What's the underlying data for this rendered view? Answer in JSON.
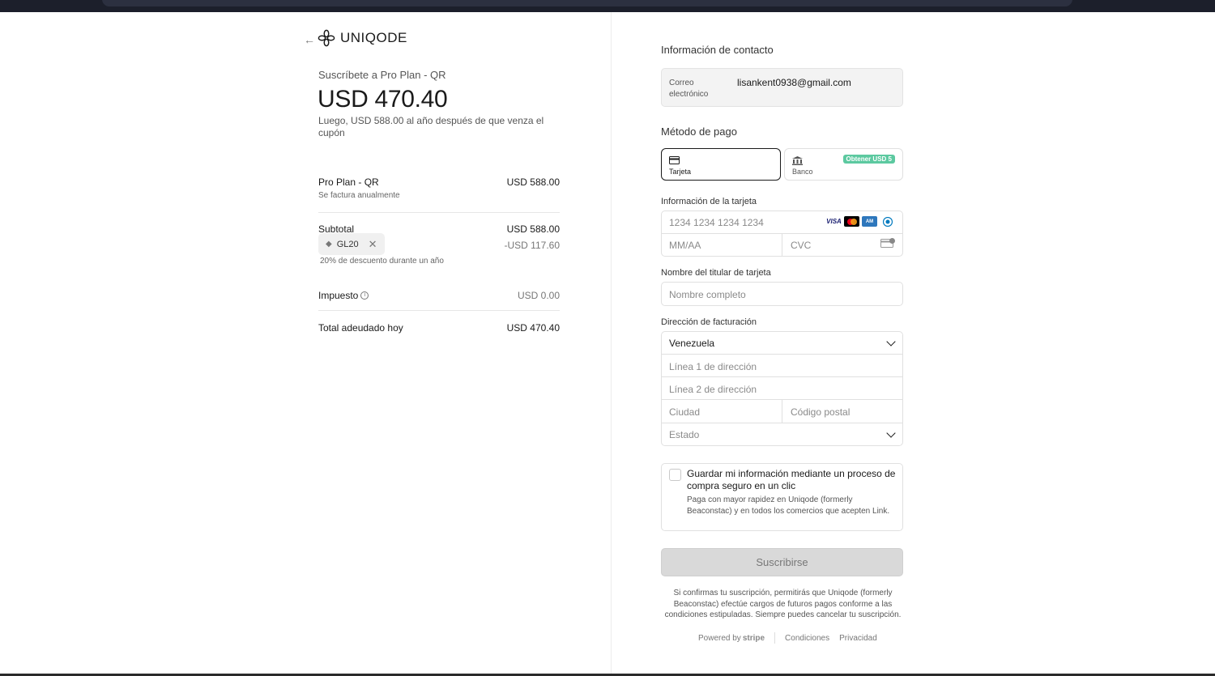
{
  "brand": {
    "name": "UNIQODE"
  },
  "summary": {
    "subscribe_to": "Suscríbete a Pro Plan - QR",
    "price": "USD 470.40",
    "price_note": "Luego, USD 588.00 al año después de que venza el cupón",
    "plan_name": "Pro Plan - QR",
    "plan_amount": "USD 588.00",
    "plan_billing": "Se factura anualmente",
    "subtotal_label": "Subtotal",
    "subtotal_amount": "USD 588.00",
    "coupon_code": "GL20",
    "coupon_amount": "-USD 117.60",
    "coupon_description": "20% de descuento durante un año",
    "tax_label": "Impuesto",
    "tax_amount": "USD 0.00",
    "total_label": "Total adeudado hoy",
    "total_amount": "USD 470.40"
  },
  "contact": {
    "section_title": "Información de contacto",
    "email_label": "Correo electrónico",
    "email_value": "lisankent0938@gmail.com"
  },
  "payment": {
    "section_title": "Método de pago",
    "tabs": [
      {
        "label": "Tarjeta",
        "icon": "card-icon",
        "active": true
      },
      {
        "label": "Banco",
        "icon": "bank-icon",
        "active": false,
        "badge": "Obtener USD 5"
      }
    ],
    "card_info_label": "Información de la tarjeta",
    "card_number_placeholder": "1234 1234 1234 1234",
    "card_brands": [
      "VISA",
      "Mastercard",
      "AMEX",
      "Diners"
    ],
    "expiry_placeholder": "MM/AA",
    "cvc_placeholder": "CVC",
    "holder_label": "Nombre del titular de tarjeta",
    "holder_placeholder": "Nombre completo",
    "billing_label": "Dirección de facturación",
    "country_value": "Venezuela",
    "address1_placeholder": "Línea 1 de dirección",
    "address2_placeholder": "Línea 2 de dirección",
    "city_placeholder": "Ciudad",
    "postal_placeholder": "Código postal",
    "state_placeholder": "Estado"
  },
  "save_info": {
    "title": "Guardar mi información mediante un proceso de compra seguro en un clic",
    "description": "Paga con mayor rapidez en Uniqode (formerly Beaconstac) y en todos los comercios que acepten Link."
  },
  "submit_label": "Suscribirse",
  "terms_text": "Si confirmas tu suscripción, permitirás que Uniqode (formerly Beaconstac) efectúe cargos de futuros pagos conforme a las condiciones estipuladas. Siempre puedes cancelar tu suscripción.",
  "footer": {
    "powered_by": "Powered by",
    "stripe": "stripe",
    "terms_link": "Condiciones",
    "privacy_link": "Privacidad"
  },
  "colors": {
    "accent_badge": "#5cc9a0",
    "submit_disabled": "#d9d9d9"
  }
}
